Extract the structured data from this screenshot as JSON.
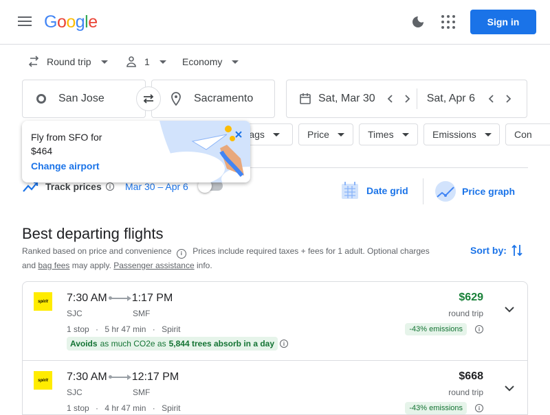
{
  "header": {
    "brand": "Google",
    "sign_in": "Sign in"
  },
  "search": {
    "trip_type": "Round trip",
    "passengers": "1",
    "cabin": "Economy",
    "origin": "San Jose",
    "destination": "Sacramento",
    "depart_date": "Sat, Mar 30",
    "return_date": "Sat, Apr 6"
  },
  "filters": [
    "Bags",
    "Price",
    "Times",
    "Emissions",
    "Con"
  ],
  "popup": {
    "line1": "Fly from SFO for",
    "line2": "$464",
    "link": "Change airport"
  },
  "tracking": {
    "label": "Track prices",
    "dates": "Mar 30 – Apr 6",
    "date_grid": "Date grid",
    "price_graph": "Price graph"
  },
  "results": {
    "title": "Best departing flights",
    "ranked": "Ranked based on price and convenience",
    "prices_note": "Prices include required taxes + fees for 1 adult. Optional charges",
    "and": "and",
    "bag_fees": "bag fees",
    "may_apply": "may apply.",
    "passenger_assistance": "Passenger assistance",
    "info": "info.",
    "sort_by": "Sort by:"
  },
  "flights": [
    {
      "airline_logo": "spirit",
      "depart": "7:30 AM",
      "arrive": "1:17 PM",
      "from": "SJC",
      "to": "SMF",
      "stops": "1 stop",
      "duration": "5 hr 47 min",
      "airline": "Spirit",
      "eco_avoids": "Avoids",
      "eco_mid": "as much CO2e as",
      "eco_trees": "5,844 trees absorb in a day",
      "price": "$629",
      "price_color": "#188038",
      "price_type": "round trip",
      "emissions": "-43% emissions"
    },
    {
      "airline_logo": "spirit",
      "depart": "7:30 AM",
      "arrive": "12:17 PM",
      "from": "SJC",
      "to": "SMF",
      "stops": "1 stop",
      "duration": "4 hr 47 min",
      "airline": "Spirit",
      "price": "$668",
      "price_color": "#202124",
      "price_type": "round trip",
      "emissions": "-43% emissions"
    }
  ]
}
